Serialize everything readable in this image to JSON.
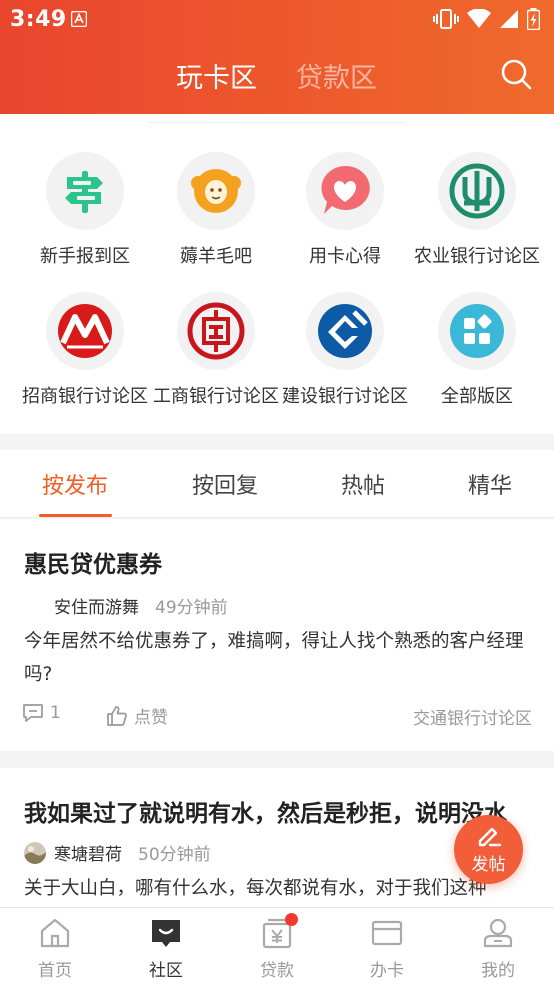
{
  "status_bar": {
    "time": "3:49"
  },
  "top_tabs": {
    "active": "玩卡区",
    "inactive": "贷款区"
  },
  "forums": [
    {
      "label": "新手报到区",
      "icon": "signpost-icon"
    },
    {
      "label": "薅羊毛吧",
      "icon": "sheep-icon"
    },
    {
      "label": "用卡心得",
      "icon": "heart-chat-icon"
    },
    {
      "label": "农业银行讨论区",
      "icon": "abc-bank-icon"
    },
    {
      "label": "招商银行讨论区",
      "icon": "cmb-bank-icon"
    },
    {
      "label": "工商银行讨论区",
      "icon": "icbc-bank-icon"
    },
    {
      "label": "建设银行讨论区",
      "icon": "ccb-bank-icon"
    },
    {
      "label": "全部版区",
      "icon": "all-sections-icon"
    }
  ],
  "sort_tabs": [
    "按发布",
    "按回复",
    "热帖",
    "精华"
  ],
  "posts": [
    {
      "title": "惠民贷优惠券",
      "author": "安住而游舞",
      "time": "49分钟前",
      "body": "今年居然不给优惠券了，难搞啊，得让人找个熟悉的客户经理吗?",
      "comments": "1",
      "like_label": "点赞",
      "forum": "交通银行讨论区"
    },
    {
      "title": "我如果过了就说明有水，然后是秒拒，说明没水",
      "author": "寒塘碧荷",
      "time": "50分钟前",
      "body": "关于大山白，哪有什么水，每次都说有水，对于我们这种"
    }
  ],
  "fab": {
    "label": "发帖"
  },
  "bottom_nav": [
    {
      "label": "首页",
      "icon": "home-icon"
    },
    {
      "label": "社区",
      "icon": "community-icon"
    },
    {
      "label": "贷款",
      "icon": "loan-icon"
    },
    {
      "label": "办卡",
      "icon": "card-icon"
    },
    {
      "label": "我的",
      "icon": "profile-icon"
    }
  ],
  "colors": {
    "accent": "#f25d23",
    "header_start": "#e9452e",
    "header_end": "#f06a2c",
    "badge": "#f23a2c"
  }
}
